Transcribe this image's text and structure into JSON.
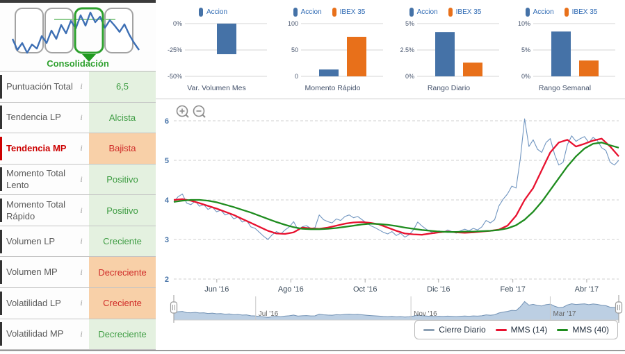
{
  "pattern_selector": {
    "selected_label": "Consolidación",
    "pattern_count": 4,
    "selected_index": 2
  },
  "indicators_table": {
    "info_icon": "i",
    "rows": [
      {
        "label": "Puntuación Total",
        "value": "6,5",
        "status": "positive",
        "highlighted": false
      },
      {
        "label": "Tendencia LP",
        "value": "Alcista",
        "status": "positive",
        "highlighted": false
      },
      {
        "label": "Tendencia MP",
        "value": "Bajista",
        "status": "negative",
        "highlighted": true
      },
      {
        "label": "Momento Total Lento",
        "value": "Positivo",
        "status": "positive",
        "highlighted": false
      },
      {
        "label": "Momento Total Rápido",
        "value": "Positivo",
        "status": "positive",
        "highlighted": false
      },
      {
        "label": "Volumen LP",
        "value": "Creciente",
        "status": "positive",
        "highlighted": false
      },
      {
        "label": "Volumen MP",
        "value": "Decreciente",
        "status": "negative",
        "highlighted": false
      },
      {
        "label": "Volatilidad LP",
        "value": "Creciente",
        "status": "negative",
        "highlighted": false
      },
      {
        "label": "Volatilidad MP",
        "value": "Decreciente",
        "status": "positive",
        "highlighted": false
      }
    ]
  },
  "colors": {
    "accion": "#4572a7",
    "ibex": "#e8701a",
    "cierre": "#7095c0",
    "mms14": "#e8112f",
    "mms40": "#1e8c1e",
    "positive_bg": "#e4f1e0",
    "positive_text": "#3f9d44",
    "negative_bg": "#f8d0a8",
    "negative_text": "#cf2a27",
    "pattern_green": "#2da02d",
    "legend_cierre_swatch": "#8ca0b4"
  },
  "chart_data": [
    {
      "type": "bar",
      "title": "Var. Volumen Mes",
      "legend": [
        "Accion"
      ],
      "y_ticks": [
        "0%",
        "-25%",
        "-50%"
      ],
      "ylim": [
        -50,
        0
      ],
      "series": [
        {
          "name": "Accion",
          "value": -29
        }
      ]
    },
    {
      "type": "bar",
      "title": "Momento Rápido",
      "legend": [
        "Accion",
        "IBEX 35"
      ],
      "y_ticks": [
        "100",
        "50",
        "0"
      ],
      "ylim": [
        0,
        100
      ],
      "series": [
        {
          "name": "Accion",
          "value": 13
        },
        {
          "name": "IBEX 35",
          "value": 75
        }
      ]
    },
    {
      "type": "bar",
      "title": "Rango Diario",
      "legend": [
        "Accion",
        "IBEX 35"
      ],
      "y_ticks": [
        "5%",
        "2.5%",
        "0%"
      ],
      "ylim": [
        0,
        5
      ],
      "series": [
        {
          "name": "Accion",
          "value": 4.2
        },
        {
          "name": "IBEX 35",
          "value": 1.3
        }
      ]
    },
    {
      "type": "bar",
      "title": "Rango Semanal",
      "legend": [
        "Accion",
        "IBEX 35"
      ],
      "y_ticks": [
        "10%",
        "5%",
        "0%"
      ],
      "ylim": [
        0,
        10
      ],
      "series": [
        {
          "name": "Accion",
          "value": 8.5
        },
        {
          "name": "IBEX 35",
          "value": 3.0
        }
      ]
    },
    {
      "type": "line",
      "title": "",
      "y_ticks": [
        "2",
        "3",
        "4",
        "5",
        "6"
      ],
      "ylim": [
        2,
        6.5
      ],
      "grid": "dashed",
      "x_labels": [
        "Jun '16",
        "Ago '16",
        "Oct '16",
        "Dic '16",
        "Feb '17",
        "Abr '17"
      ],
      "navigator_labels": [
        "Jul '16",
        "Nov '16",
        "Mar '17"
      ],
      "legend": [
        "Cierre Diario",
        "MMS (14)",
        "MMS (40)"
      ],
      "series": [
        {
          "name": "Cierre Diario",
          "values": [
            3.95,
            4.08,
            4.15,
            3.92,
            3.88,
            3.97,
            3.84,
            3.88,
            3.76,
            3.82,
            3.7,
            3.74,
            3.62,
            3.66,
            3.52,
            3.57,
            3.44,
            3.48,
            3.32,
            3.28,
            3.18,
            3.08,
            3.0,
            3.12,
            3.2,
            3.14,
            3.24,
            3.32,
            3.45,
            3.25,
            3.32,
            3.35,
            3.28,
            3.3,
            3.62,
            3.5,
            3.45,
            3.42,
            3.52,
            3.48,
            3.58,
            3.62,
            3.55,
            3.58,
            3.5,
            3.42,
            3.35,
            3.3,
            3.24,
            3.18,
            3.14,
            3.2,
            3.1,
            3.16,
            3.06,
            3.12,
            3.24,
            3.44,
            3.34,
            3.26,
            3.2,
            3.15,
            3.22,
            3.18,
            3.24,
            3.2,
            3.16,
            3.22,
            3.26,
            3.22,
            3.28,
            3.24,
            3.32,
            3.48,
            3.42,
            3.5,
            3.85,
            4.02,
            4.15,
            4.35,
            4.3,
            5.05,
            6.05,
            5.35,
            5.52,
            5.28,
            5.2,
            5.45,
            5.55,
            5.15,
            4.88,
            4.95,
            5.4,
            5.62,
            5.48,
            5.55,
            5.6,
            5.45,
            5.58,
            5.5,
            5.32,
            5.25,
            4.95,
            4.88,
            5.0
          ]
        },
        {
          "name": "MMS (14)",
          "values": [
            4.0,
            4.02,
            3.98,
            3.92,
            3.85,
            3.78,
            3.7,
            3.62,
            3.52,
            3.42,
            3.32,
            3.22,
            3.15,
            3.14,
            3.18,
            3.3,
            3.28,
            3.27,
            3.3,
            3.35,
            3.4,
            3.43,
            3.44,
            3.42,
            3.38,
            3.3,
            3.22,
            3.15,
            3.13,
            3.12,
            3.15,
            3.18,
            3.2,
            3.18,
            3.17,
            3.18,
            3.2,
            3.22,
            3.25,
            3.35,
            3.6,
            4.0,
            4.3,
            4.75,
            5.2,
            5.45,
            5.52,
            5.35,
            5.42,
            5.5,
            5.55,
            5.35,
            5.1
          ]
        },
        {
          "name": "MMS (40)",
          "values": [
            3.95,
            3.98,
            4.0,
            4.0,
            3.98,
            3.94,
            3.88,
            3.82,
            3.75,
            3.68,
            3.6,
            3.52,
            3.44,
            3.37,
            3.31,
            3.27,
            3.26,
            3.26,
            3.27,
            3.29,
            3.32,
            3.35,
            3.38,
            3.4,
            3.39,
            3.37,
            3.34,
            3.3,
            3.27,
            3.24,
            3.22,
            3.2,
            3.19,
            3.19,
            3.2,
            3.2,
            3.21,
            3.22,
            3.24,
            3.28,
            3.36,
            3.5,
            3.7,
            3.95,
            4.25,
            4.55,
            4.85,
            5.1,
            5.3,
            5.42,
            5.45,
            5.38,
            5.32
          ]
        }
      ]
    }
  ]
}
